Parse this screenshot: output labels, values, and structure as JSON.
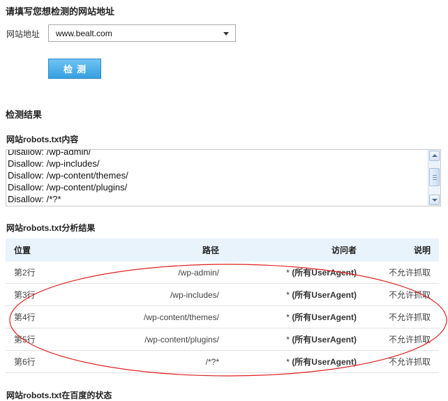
{
  "form": {
    "title": "请填写您想检测的网站地址",
    "url_label": "网站地址",
    "url_value": "www.bealt.com",
    "check_button": "检测"
  },
  "results": {
    "title": "检测结果",
    "robots_content_title": "网站robots.txt内容",
    "robots_lines": [
      "Disallow: /wp-admin/",
      "Disallow: /wp-includes/",
      "Disallow: /wp-content/themes/",
      "Disallow: /wp-content/plugins/",
      "Disallow: /*?*"
    ],
    "analysis_title": "网站robots.txt分析结果",
    "table": {
      "headers": {
        "position": "位置",
        "path": "路径",
        "visitor": "访问者",
        "note": "说明"
      },
      "rows": [
        {
          "position": "第2行",
          "path": "/wp-admin/",
          "visitor_star": "*",
          "visitor_label": "(所有UserAgent)",
          "note": "不允许抓取"
        },
        {
          "position": "第3行",
          "path": "/wp-includes/",
          "visitor_star": "*",
          "visitor_label": "(所有UserAgent)",
          "note": "不允许抓取"
        },
        {
          "position": "第4行",
          "path": "/wp-content/themes/",
          "visitor_star": "*",
          "visitor_label": "(所有UserAgent)",
          "note": "不允许抓取"
        },
        {
          "position": "第5行",
          "path": "/wp-content/plugins/",
          "visitor_star": "*",
          "visitor_label": "(所有UserAgent)",
          "note": "不允许抓取"
        },
        {
          "position": "第6行",
          "path": "/*?*",
          "visitor_star": "*",
          "visitor_label": "(所有UserAgent)",
          "note": "不允许抓取"
        }
      ]
    },
    "baidu_status_title": "网站robots.txt在百度的状态"
  },
  "icons": {
    "dropdown": "chevron-down-icon",
    "scroll_up": "arrow-up-icon",
    "scroll_down": "arrow-down-icon"
  },
  "colors": {
    "button_blue": "#36a0e0",
    "table_header_bg": "#e9f3fc",
    "annotation_red": "#e02020"
  }
}
